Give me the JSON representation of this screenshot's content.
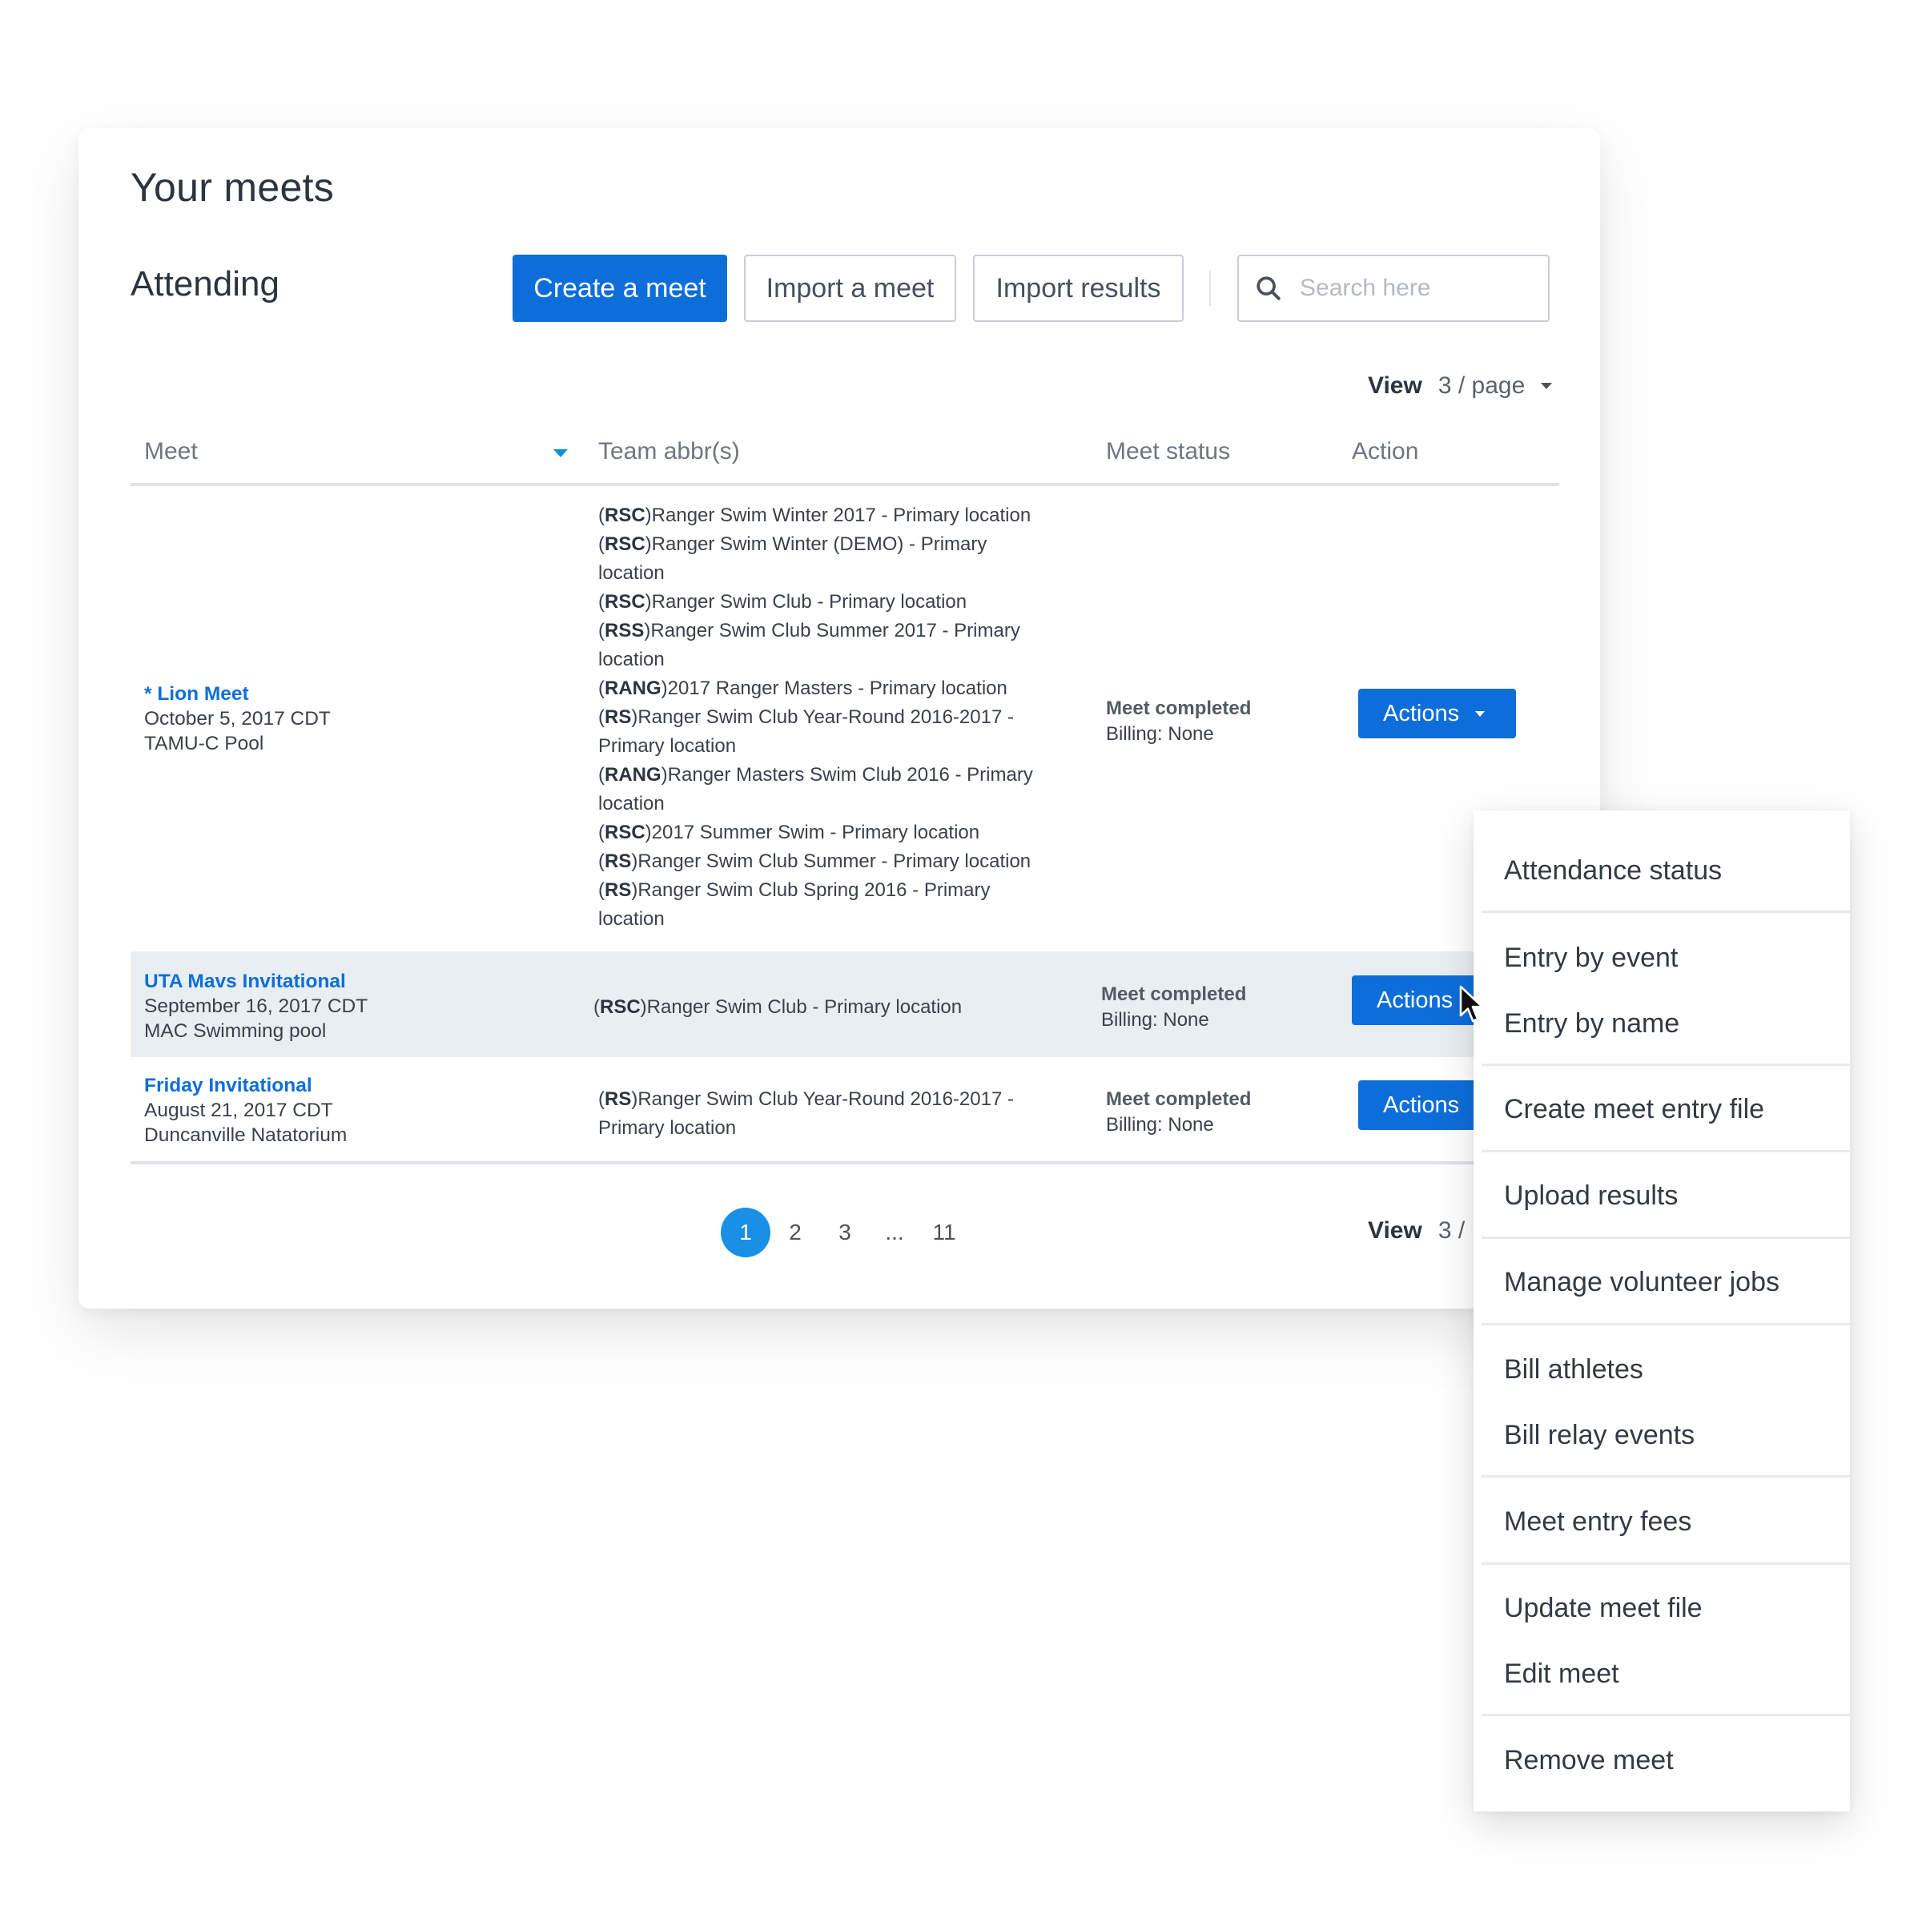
{
  "page": {
    "title": "Your meets",
    "section": "Attending"
  },
  "toolbar": {
    "create": "Create a meet",
    "import": "Import a meet",
    "import_results": "Import results",
    "search_placeholder": "Search here"
  },
  "view": {
    "label": "View",
    "value": "3 / page",
    "value_bottom": "3 /"
  },
  "table": {
    "headers": [
      "Meet",
      "Team abbr(s)",
      "Meet status",
      "Action"
    ],
    "rows": [
      {
        "name": "* Lion Meet",
        "date": "October 5, 2017 CDT",
        "location": "TAMU-C Pool",
        "teams": [
          {
            "abbr": "RSC",
            "text": "Ranger Swim Winter 2017 - Primary location"
          },
          {
            "abbr": "RSC",
            "text": "Ranger Swim Winter (DEMO) - Primary"
          },
          {
            "abbr": "",
            "text": "location"
          },
          {
            "abbr": "RSC",
            "text": "Ranger Swim Club - Primary location"
          },
          {
            "abbr": "RSS",
            "text": "Ranger Swim Club Summer 2017 - Primary"
          },
          {
            "abbr": "",
            "text": "location"
          },
          {
            "abbr": "RANG",
            "text": "2017 Ranger Masters - Primary location"
          },
          {
            "abbr": "RS",
            "text": "Ranger Swim Club Year-Round 2016-2017 -"
          },
          {
            "abbr": "",
            "text": "Primary location"
          },
          {
            "abbr": "RANG",
            "text": "Ranger Masters Swim Club 2016 - Primary"
          },
          {
            "abbr": "",
            "text": "location"
          },
          {
            "abbr": "RSC",
            "text": "2017 Summer Swim - Primary location"
          },
          {
            "abbr": "RS",
            "text": "Ranger Swim Club Summer - Primary location"
          },
          {
            "abbr": "RS",
            "text": "Ranger Swim Club Spring 2016 - Primary"
          },
          {
            "abbr": "",
            "text": "location"
          }
        ],
        "status": "Meet completed",
        "billing": "Billing: None",
        "action": "Actions"
      },
      {
        "name": "UTA Mavs Invitational",
        "date": "September 16, 2017 CDT",
        "location": "MAC Swimming pool",
        "teams": [
          {
            "abbr": "RSC",
            "text": "Ranger Swim Club - Primary location"
          }
        ],
        "status": "Meet completed",
        "billing": "Billing: None",
        "action": "Actions"
      },
      {
        "name": "Friday Invitational",
        "date": "August 21, 2017 CDT",
        "location": "Duncanville Natatorium",
        "teams": [
          {
            "abbr": "RS",
            "text": "Ranger Swim Club Year-Round 2016-2017 -"
          },
          {
            "abbr": "",
            "text": "Primary location"
          }
        ],
        "status": "Meet completed",
        "billing": "Billing: None",
        "action": "Actions"
      }
    ]
  },
  "pagination": {
    "pages": [
      "1",
      "2",
      "3",
      "...",
      "11"
    ],
    "current": "1"
  },
  "menu": {
    "items": [
      "Attendance status",
      "Entry by event",
      "Entry by name",
      "Create meet entry file",
      "Upload results",
      "Manage volunteer jobs",
      "Bill athletes",
      "Bill relay events",
      "Meet entry fees",
      "Update meet file",
      "Edit meet",
      "Remove meet"
    ]
  },
  "colors": {
    "primary": "#0d6ed9",
    "pager_active": "#1a8fe6",
    "row_highlight": "#e8eef1"
  }
}
